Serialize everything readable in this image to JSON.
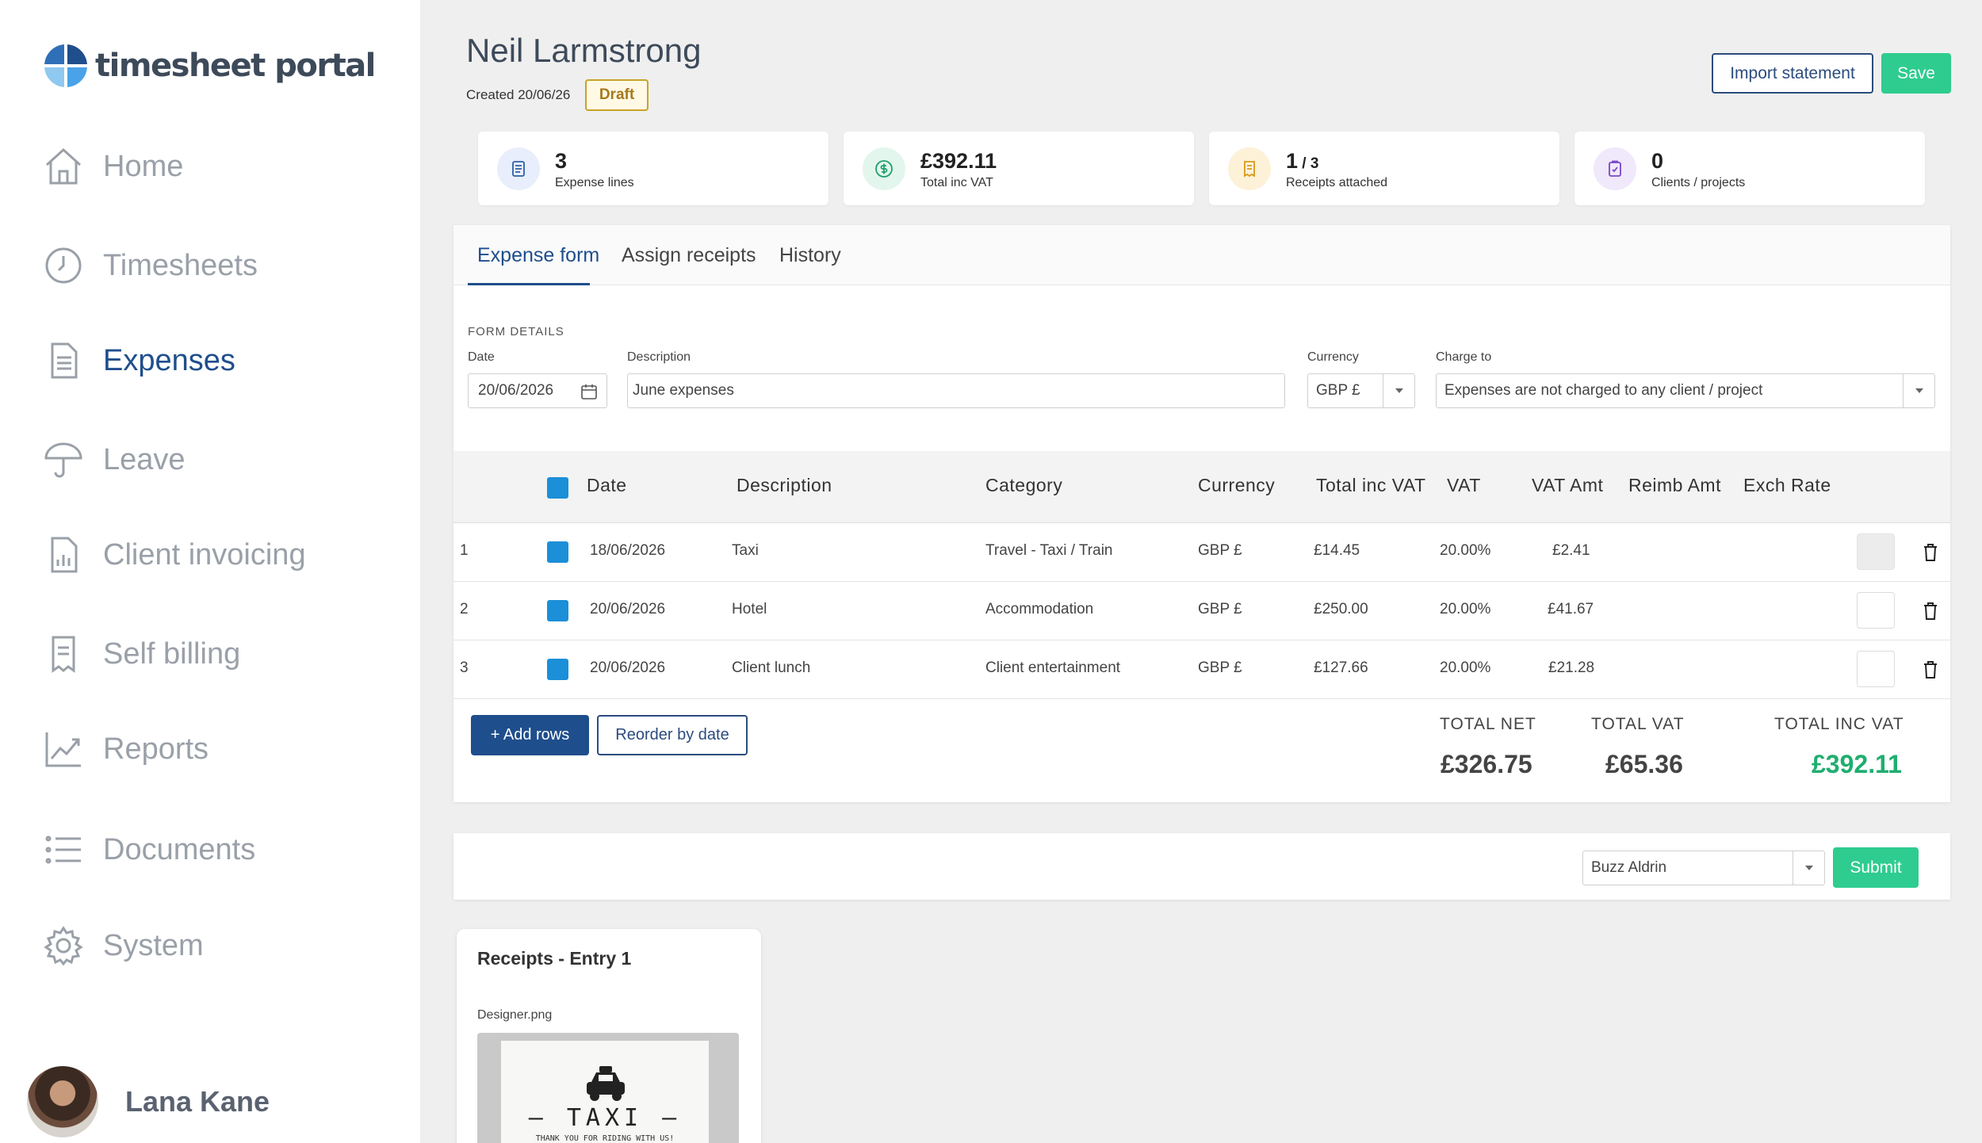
{
  "app": {
    "logo_text": "timesheet portal"
  },
  "sidebar": {
    "items": [
      {
        "label": "Home",
        "icon": "home-icon"
      },
      {
        "label": "Timesheets",
        "icon": "clock-icon"
      },
      {
        "label": "Expenses",
        "icon": "document-icon",
        "active": true
      },
      {
        "label": "Leave",
        "icon": "umbrella-icon"
      },
      {
        "label": "Client invoicing",
        "icon": "invoice-chart-icon"
      },
      {
        "label": "Self billing",
        "icon": "receipt-icon"
      },
      {
        "label": "Reports",
        "icon": "trend-chart-icon"
      },
      {
        "label": "Documents",
        "icon": "list-icon"
      },
      {
        "label": "System",
        "icon": "gear-icon"
      }
    ],
    "user": {
      "name": "Lana Kane"
    }
  },
  "header": {
    "name": "Neil Larmstrong",
    "created": "Created 20/06/26",
    "status": "Draft",
    "import_label": "Import statement",
    "save_label": "Save"
  },
  "stats": [
    {
      "value": "3",
      "value_suffix": "",
      "label": "Expense lines",
      "icon": "list-doc-icon",
      "color": "#e8eefb"
    },
    {
      "value": "£392.11",
      "value_suffix": "",
      "label": "Total inc VAT",
      "icon": "dollar-icon",
      "color": "#e3f6ee"
    },
    {
      "value": "1",
      "value_suffix": " / 3",
      "label": "Receipts attached",
      "icon": "receipt-icon",
      "color": "#fdf1d8"
    },
    {
      "value": "0",
      "value_suffix": "",
      "label": "Clients / projects",
      "icon": "clipboard-check-icon",
      "color": "#f0e8fb"
    }
  ],
  "tabs": [
    "Expense form",
    "Assign receipts",
    "History"
  ],
  "form": {
    "section_title": "FORM DETAILS",
    "date_label": "Date",
    "date_value": "20/06/2026",
    "description_label": "Description",
    "description_value": "June expenses",
    "currency_label": "Currency",
    "currency_value": "GBP £",
    "charge_label": "Charge to",
    "charge_value": "Expenses are not charged to any client / project"
  },
  "table": {
    "headers": [
      "Date",
      "Description",
      "Category",
      "Currency",
      "Total inc VAT",
      "VAT",
      "VAT Amt",
      "Reimb Amt",
      "Exch Rate"
    ],
    "rows": [
      {
        "num": "1",
        "date": "18/06/2026",
        "description": "Taxi",
        "category": "Travel - Taxi / Train",
        "currency": "GBP £",
        "total": "£14.45",
        "vat": "20.00%",
        "vat_amt": "£2.41"
      },
      {
        "num": "2",
        "date": "20/06/2026",
        "description": "Hotel",
        "category": "Accommodation",
        "currency": "GBP £",
        "total": "£250.00",
        "vat": "20.00%",
        "vat_amt": "£41.67"
      },
      {
        "num": "3",
        "date": "20/06/2026",
        "description": "Client lunch",
        "category": "Client entertainment",
        "currency": "GBP £",
        "total": "£127.66",
        "vat": "20.00%",
        "vat_amt": "£21.28"
      }
    ]
  },
  "actions": {
    "add_rows": "+ Add rows",
    "reorder": "Reorder by date"
  },
  "totals": {
    "net_label": "TOTAL NET",
    "net_value": "£326.75",
    "vat_label": "TOTAL VAT",
    "vat_value": "£65.36",
    "inc_label": "TOTAL INC VAT",
    "inc_value": "£392.11"
  },
  "submit": {
    "approver": "Buzz Aldrin",
    "submit_label": "Submit"
  },
  "receipt": {
    "title": "Receipts - Entry 1",
    "filename": "Designer.png",
    "image_text": "TAXI",
    "image_subtext": "THANK YOU FOR RIDING WITH US!"
  },
  "colors": {
    "primary": "#1f4e8c",
    "success": "#2ecc8f",
    "checkbox": "#1b8fd8"
  }
}
